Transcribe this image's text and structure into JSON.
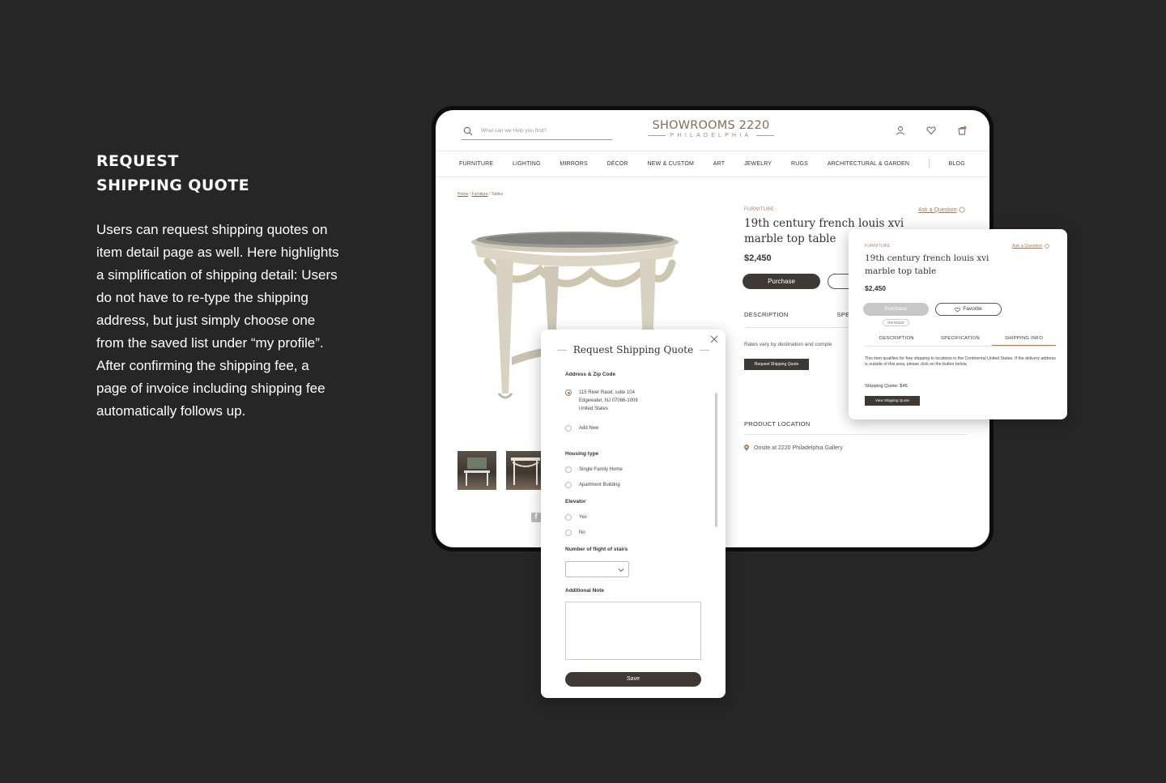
{
  "intro": {
    "title_line1": "REQUEST",
    "title_line2": "SHIPPING QUOTE",
    "paragraph1": "Users can request shipping quotes on item detail page as well. Here highlights a simplification of shipping detail: Users do not have to re-type the shipping address, but  just simply choose one from the saved list under “my profile”.",
    "paragraph2": "After confirming the shipping fee, a page of invoice including shipping fee automatically follows up."
  },
  "header": {
    "search_placeholder": "What can we Help you find?",
    "logo_main": "SHOWROOMS 2220",
    "logo_sub": "PHILADELPHIA"
  },
  "nav": {
    "items": [
      "FURNITURE",
      "LIGHTING",
      "MIRRORS",
      "DÉCOR",
      "NEW & CUSTOM",
      "ART",
      "JEWELRY",
      "RUGS",
      "ARCHITECTURAL & GARDEN",
      "BLOG"
    ]
  },
  "breadcrumb": {
    "home": "Home",
    "furniture": "Furniture",
    "current": "Tables"
  },
  "product": {
    "category": "FURNITURE",
    "ask_question": "Ask a Question",
    "title": "19th century french louis xvi marble top table",
    "price": "$2,450",
    "purchase_label": "Purchase",
    "tab_description": "DESCRIPTION",
    "tab_specification_partial": "SPEC",
    "rates_text": "Rates vary by destination and comple",
    "request_quote_label": "Request Shipping Quote",
    "location_title": "PRODUCT LOCATION",
    "location_text": "Onsite at 2220 Philadelphia Gallery",
    "facebook_glyph": "f"
  },
  "modal": {
    "title": "Request Shipping Quote",
    "address_label": "Address & Zip Code",
    "address_line1": "115 River Raod, suite 104",
    "address_line2": "Edgewater, NJ 07086-1009",
    "address_line3": "United States",
    "add_new": "Add New",
    "housing_label": "Housing type",
    "housing_opt1": "Single Family Home",
    "housing_opt2": "Apartment Building",
    "elevator_label": "Elevator",
    "elevator_yes": "Yes",
    "elevator_no": "No",
    "stairs_label": "Number of flight of stairs",
    "note_label": "Additional Note",
    "save_label": "Save"
  },
  "shipping_card": {
    "category": "FURNITURE",
    "ask_question": "Ask a Question",
    "title": "19th century french louis xvi marble top table",
    "price": "$2,450",
    "purchase_label": "Purchase",
    "favorite_label": "Favorite",
    "hold_badge": "ON HOLD",
    "tab_description": "DESCRIPTION",
    "tab_specification": "SPECIFICATION",
    "tab_shipping": "SHIPPING INFO",
    "note": "This item qualifies for free shipping to locations in the Continental United States. If the delivery address is outside of this area, please click on the button below.",
    "quote": "Shipping Quote: $45",
    "view_quote_label": "View Shipping Quote"
  },
  "colors": {
    "accent": "#b07d5f",
    "dark_button": "#3f3935",
    "background": "#262626"
  }
}
